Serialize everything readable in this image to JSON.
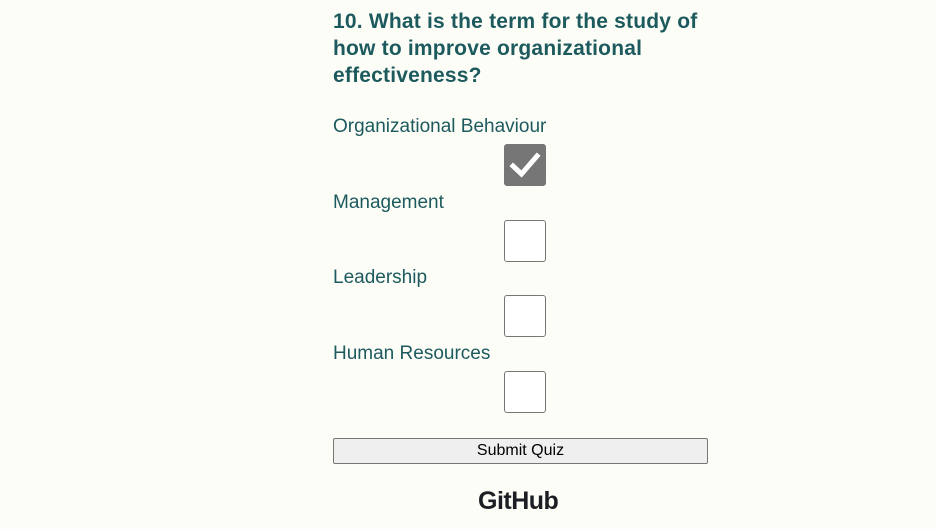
{
  "quiz": {
    "question": "10. What is the term for the study of how to improve organizational effectiveness?",
    "options": [
      {
        "label": "Organizational Behaviour",
        "checked": true
      },
      {
        "label": "Management",
        "checked": false
      },
      {
        "label": "Leadership",
        "checked": false
      },
      {
        "label": "Human Resources",
        "checked": false
      }
    ],
    "submit_label": "Submit Quiz"
  },
  "footer": {
    "github_label": "GitHub"
  },
  "colors": {
    "background": "#fdfdf8",
    "text_accent": "#1d5a5e",
    "checkbox_checked": "#767676"
  },
  "icons": {
    "checkmark": "checkmark-icon"
  }
}
